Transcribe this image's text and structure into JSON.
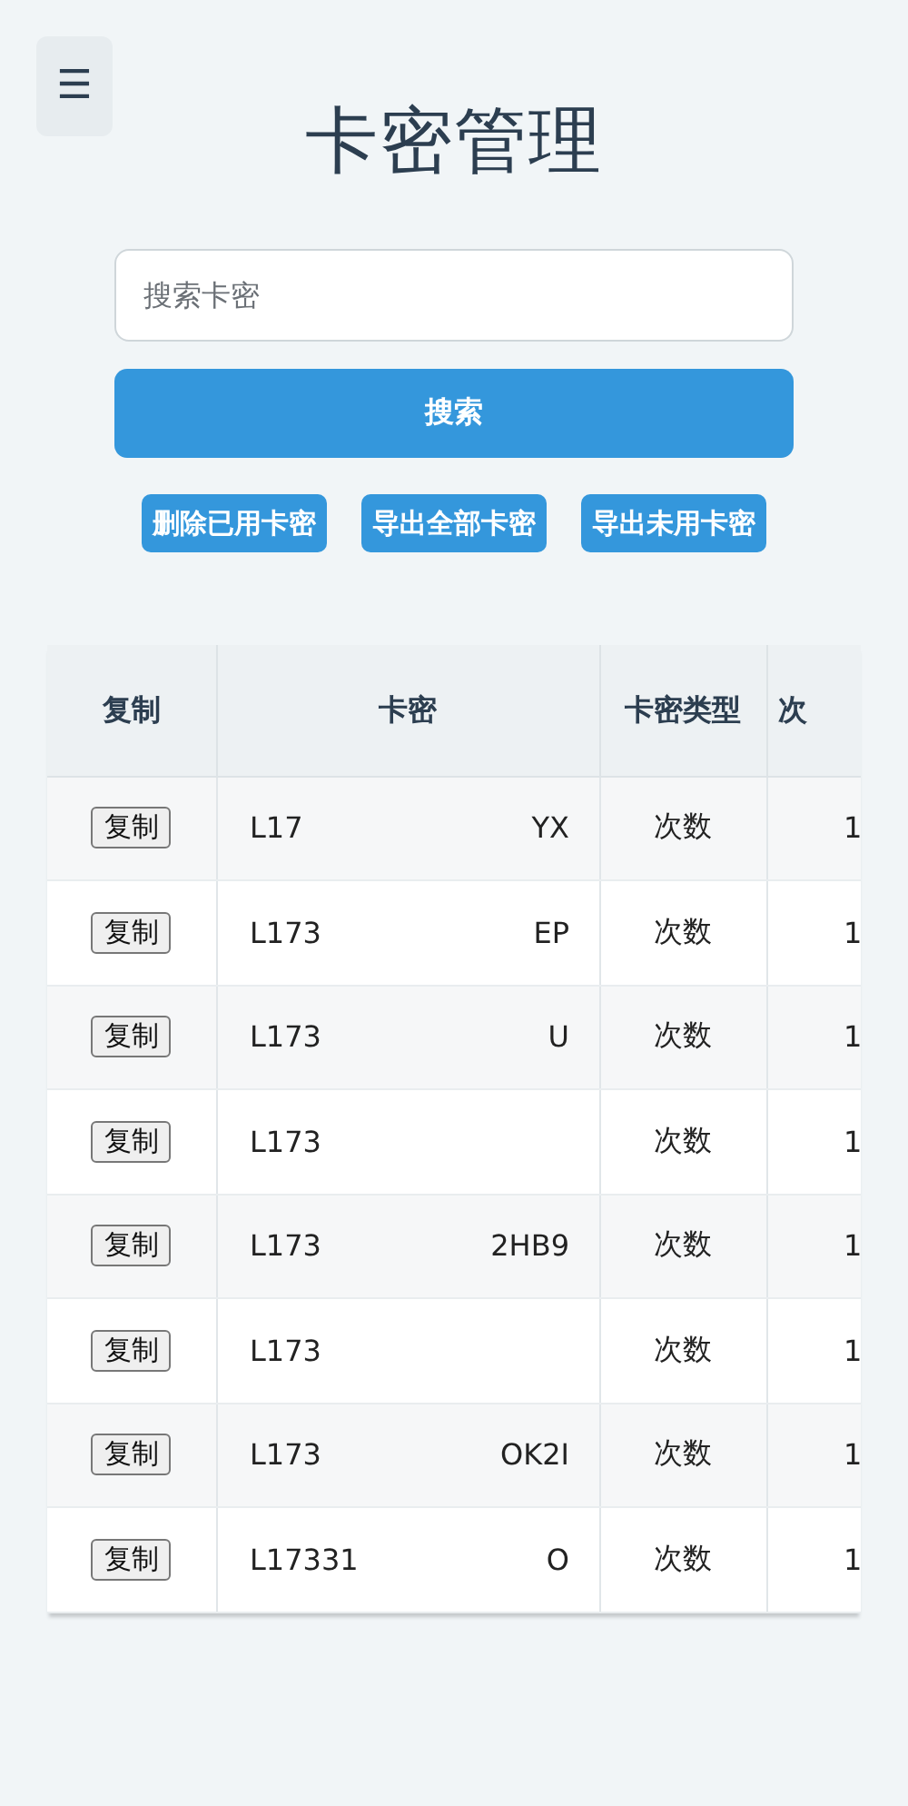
{
  "menu_button": {
    "label": "☰"
  },
  "title": "卡密管理",
  "search": {
    "placeholder": "搜索卡密",
    "button": "搜索"
  },
  "actions": [
    "删除已用卡密",
    "导出全部卡密",
    "导出未用卡密"
  ],
  "table": {
    "columns": [
      "复制",
      "卡密",
      "卡密类型",
      "次"
    ],
    "rows": [
      {
        "copy": "复制",
        "key_start": "L17",
        "key_end": "YX",
        "type": "次数",
        "column_4": "1"
      },
      {
        "copy": "复制",
        "key_start": "L173",
        "key_end": "EP",
        "type": "次数",
        "column_4": "1"
      },
      {
        "copy": "复制",
        "key_start": "L173",
        "key_end": "U",
        "type": "次数",
        "column_4": "1"
      },
      {
        "copy": "复制",
        "key_start": "L173",
        "type": "次数",
        "column_4": "1"
      },
      {
        "copy": "复制",
        "key_start": "L173",
        "key_end": "2HB9",
        "type": "次数",
        "column_4": "1"
      },
      {
        "copy": "复制",
        "key_start": "L173",
        "type": "次数",
        "column_4": "1"
      },
      {
        "copy": "复制",
        "key_start": "L173",
        "key_end": "OK2I",
        "type": "次数",
        "column_4": "1"
      },
      {
        "copy": "复制",
        "key_start": "L17331",
        "key_end": "O",
        "type": "次数",
        "column_4": "1"
      }
    ]
  }
}
